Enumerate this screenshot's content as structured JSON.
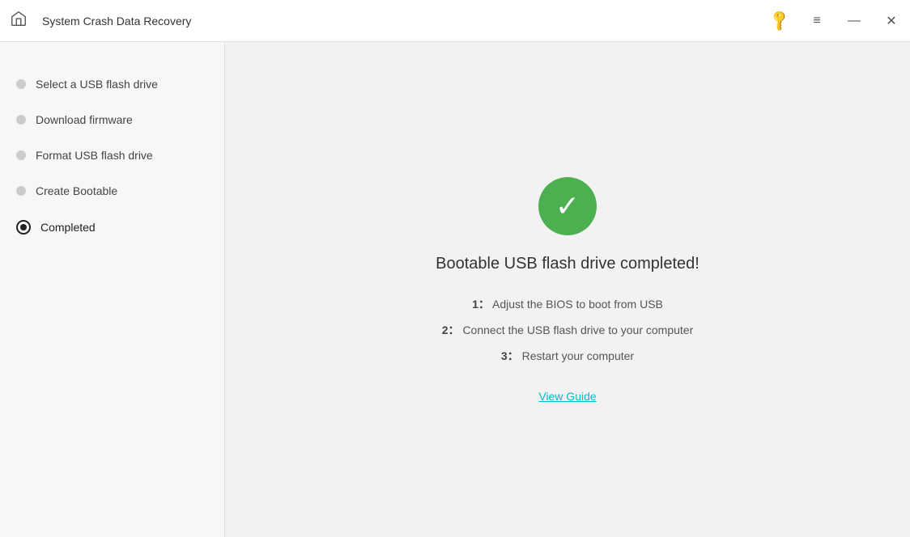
{
  "titleBar": {
    "title": "System Crash Data Recovery",
    "homeIcon": "🏠",
    "keyIcon": "🔑",
    "menuIcon": "≡",
    "minimizeIcon": "—",
    "closeIcon": "✕"
  },
  "sidebar": {
    "items": [
      {
        "id": "select-usb",
        "label": "Select a USB flash drive",
        "state": "dot",
        "active": false
      },
      {
        "id": "download-firmware",
        "label": "Download firmware",
        "state": "dot",
        "active": false
      },
      {
        "id": "format-usb",
        "label": "Format USB flash drive",
        "state": "dot",
        "active": false
      },
      {
        "id": "create-bootable",
        "label": "Create Bootable",
        "state": "dot",
        "active": false
      },
      {
        "id": "completed",
        "label": "Completed",
        "state": "active-ring",
        "active": true
      }
    ]
  },
  "content": {
    "completedTitle": "Bootable USB flash drive completed!",
    "steps": [
      {
        "number": "1：",
        "text": "Adjust the BIOS to boot from USB"
      },
      {
        "number": "2：",
        "text": "Connect the USB flash drive to your computer"
      },
      {
        "number": "3：",
        "text": "Restart your computer"
      }
    ],
    "viewGuideLabel": "View Guide"
  }
}
